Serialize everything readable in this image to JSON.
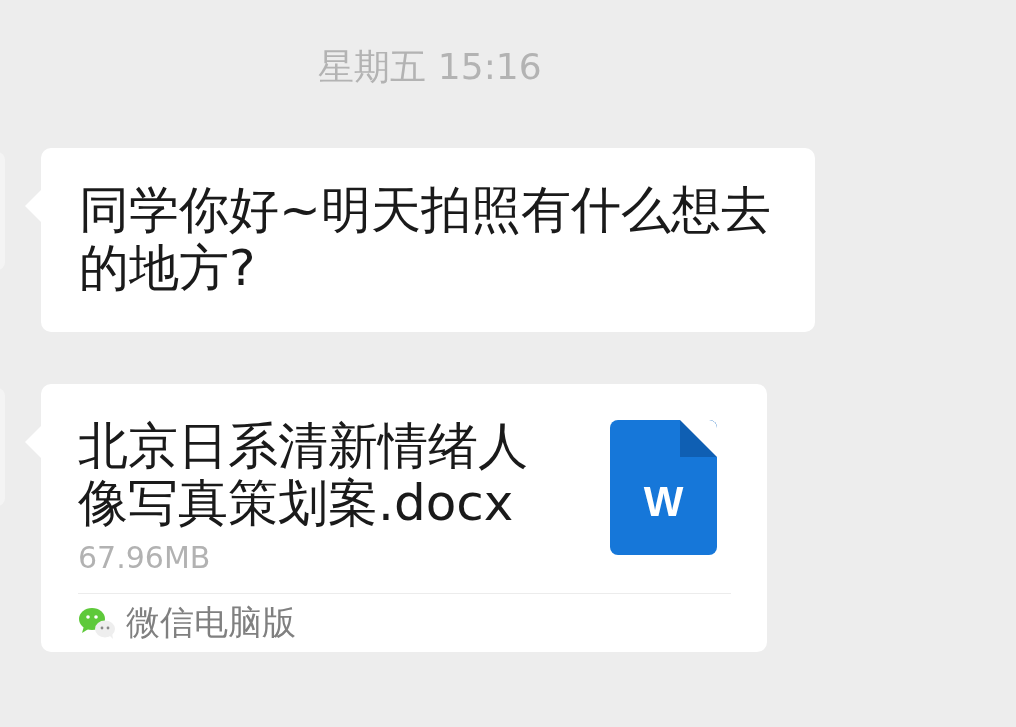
{
  "timestamp": "星期五 15:16",
  "messages": [
    {
      "kind": "text",
      "text": "同学你好~明天拍照有什么想去的地方?"
    },
    {
      "kind": "file",
      "file_name": "北京日系清新情绪人像写真策划案.docx",
      "size": "67.96MB",
      "file_icon": {
        "kind": "word",
        "letter": "W"
      },
      "source": "微信电脑版"
    }
  ]
}
